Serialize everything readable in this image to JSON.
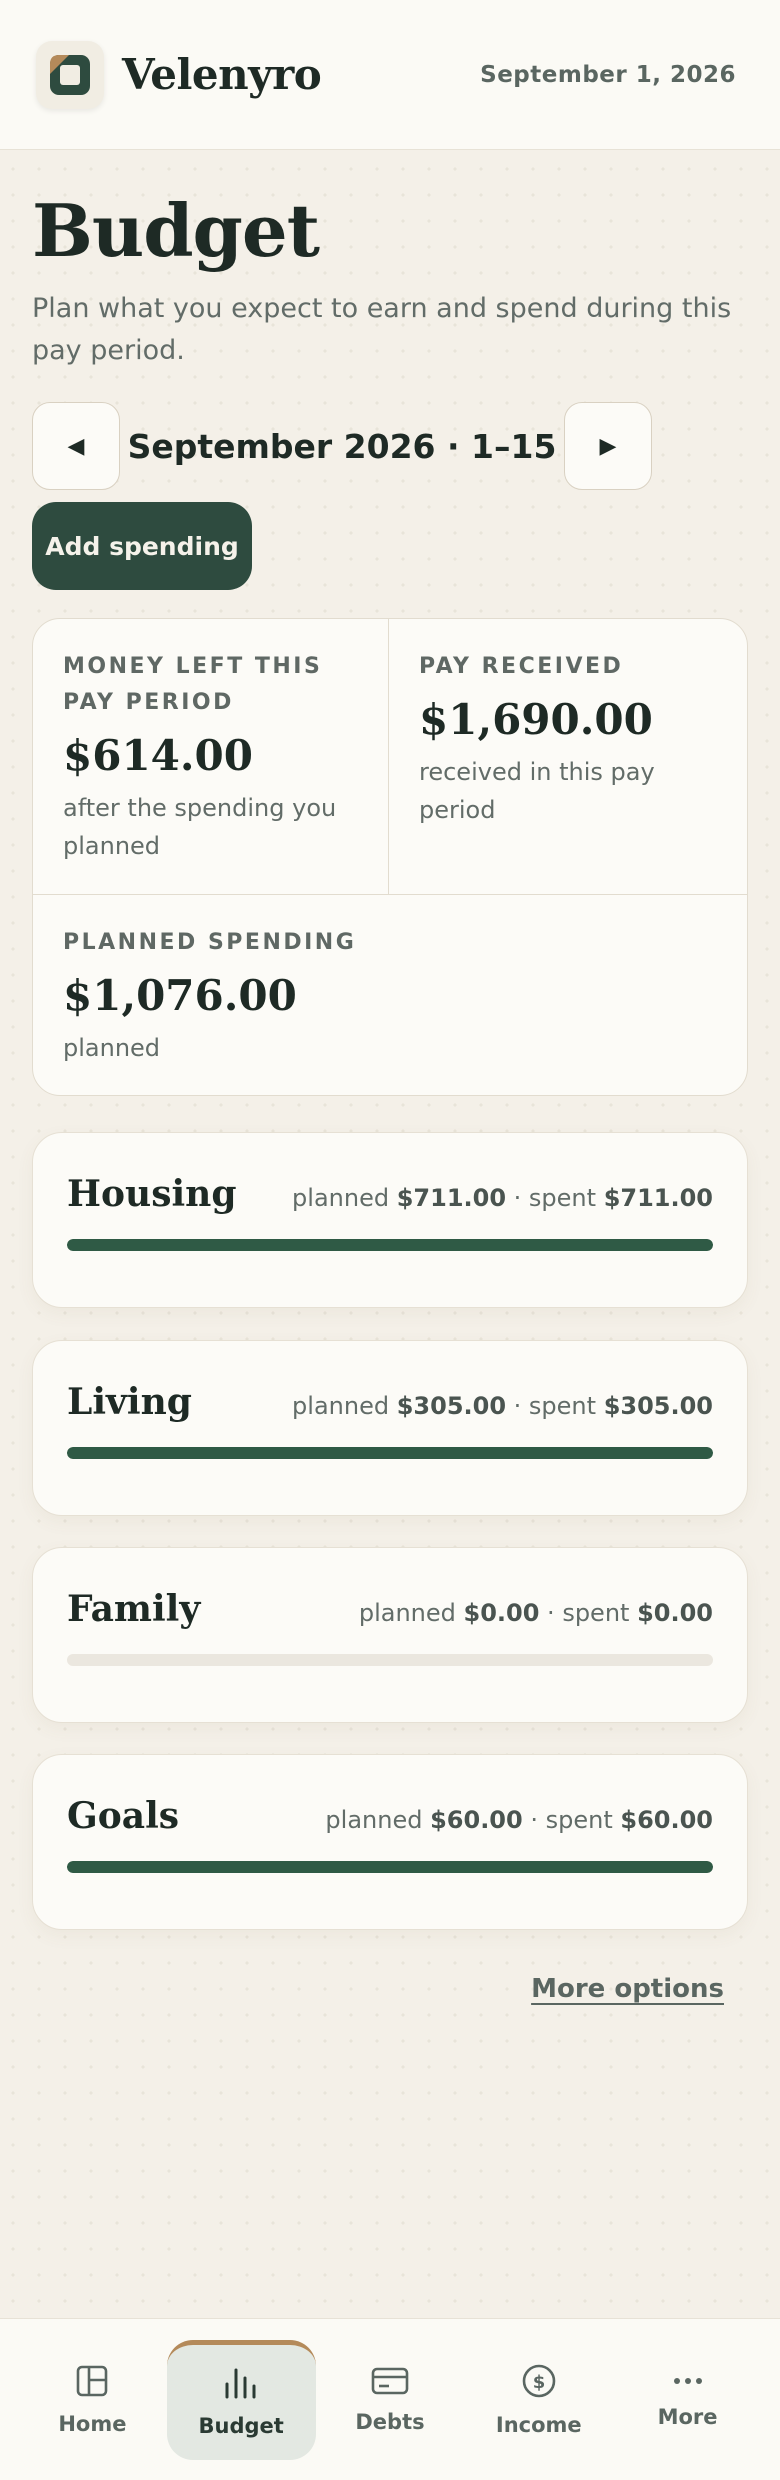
{
  "header": {
    "brand": "Velenyro",
    "date": "September 1, 2026"
  },
  "intro": {
    "title": "Budget",
    "subtitle": "Plan what you expect to earn and spend during this pay period."
  },
  "period": {
    "label": "September 2026 · 1–15",
    "prev_icon": "triangle-left-icon",
    "next_icon": "triangle-right-icon"
  },
  "actions": {
    "add_spending": "Add spending",
    "more_options": "More options"
  },
  "summary": {
    "money_left": {
      "label": "MONEY LEFT THIS PAY PERIOD",
      "value": "$614.00",
      "note": "after the spending you planned"
    },
    "pay_received": {
      "label": "PAY RECEIVED",
      "value": "$1,690.00",
      "note": "received in this pay period"
    },
    "planned_spending": {
      "label": "PLANNED SPENDING",
      "value": "$1,076.00",
      "note": "planned"
    }
  },
  "categories": [
    {
      "name": "Housing",
      "planned_label": "planned",
      "planned": "$711.00",
      "sep": " · ",
      "spent_label": "spent",
      "spent": "$711.00",
      "progress": 1.0
    },
    {
      "name": "Living",
      "planned_label": "planned",
      "planned": "$305.00",
      "sep": " · ",
      "spent_label": "spent",
      "spent": "$305.00",
      "progress": 1.0
    },
    {
      "name": "Family",
      "planned_label": "planned",
      "planned": "$0.00",
      "sep": " · ",
      "spent_label": "spent",
      "spent": "$0.00",
      "progress": 0.0
    },
    {
      "name": "Goals",
      "planned_label": "planned",
      "planned": "$60.00",
      "sep": " · ",
      "spent_label": "spent",
      "spent": "$60.00",
      "progress": 1.0
    }
  ],
  "bottom_nav": [
    {
      "label": "Home",
      "icon": "layout-icon",
      "active": false
    },
    {
      "label": "Budget",
      "icon": "bar-chart-icon",
      "active": true
    },
    {
      "label": "Debts",
      "icon": "credit-card-icon",
      "active": false
    },
    {
      "label": "Income",
      "icon": "dollar-circle-icon",
      "active": false
    },
    {
      "label": "More",
      "icon": "ellipsis-icon",
      "active": false
    }
  ],
  "colors": {
    "accent": "#2e4b3f",
    "progress": "#2f5a45",
    "active_nav_top": "#b48a5a",
    "background": "#f4f0e8"
  }
}
